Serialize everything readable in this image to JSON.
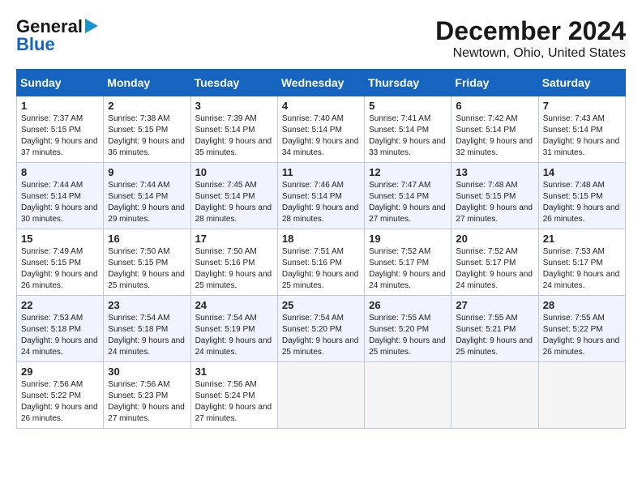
{
  "header": {
    "logo_line1": "General",
    "logo_line2": "Blue",
    "month": "December 2024",
    "location": "Newtown, Ohio, United States"
  },
  "days_of_week": [
    "Sunday",
    "Monday",
    "Tuesday",
    "Wednesday",
    "Thursday",
    "Friday",
    "Saturday"
  ],
  "weeks": [
    [
      {
        "day": "1",
        "sunrise": "7:37 AM",
        "sunset": "5:15 PM",
        "daylight": "9 hours and 37 minutes."
      },
      {
        "day": "2",
        "sunrise": "7:38 AM",
        "sunset": "5:15 PM",
        "daylight": "9 hours and 36 minutes."
      },
      {
        "day": "3",
        "sunrise": "7:39 AM",
        "sunset": "5:14 PM",
        "daylight": "9 hours and 35 minutes."
      },
      {
        "day": "4",
        "sunrise": "7:40 AM",
        "sunset": "5:14 PM",
        "daylight": "9 hours and 34 minutes."
      },
      {
        "day": "5",
        "sunrise": "7:41 AM",
        "sunset": "5:14 PM",
        "daylight": "9 hours and 33 minutes."
      },
      {
        "day": "6",
        "sunrise": "7:42 AM",
        "sunset": "5:14 PM",
        "daylight": "9 hours and 32 minutes."
      },
      {
        "day": "7",
        "sunrise": "7:43 AM",
        "sunset": "5:14 PM",
        "daylight": "9 hours and 31 minutes."
      }
    ],
    [
      {
        "day": "8",
        "sunrise": "7:44 AM",
        "sunset": "5:14 PM",
        "daylight": "9 hours and 30 minutes."
      },
      {
        "day": "9",
        "sunrise": "7:44 AM",
        "sunset": "5:14 PM",
        "daylight": "9 hours and 29 minutes."
      },
      {
        "day": "10",
        "sunrise": "7:45 AM",
        "sunset": "5:14 PM",
        "daylight": "9 hours and 28 minutes."
      },
      {
        "day": "11",
        "sunrise": "7:46 AM",
        "sunset": "5:14 PM",
        "daylight": "9 hours and 28 minutes."
      },
      {
        "day": "12",
        "sunrise": "7:47 AM",
        "sunset": "5:14 PM",
        "daylight": "9 hours and 27 minutes."
      },
      {
        "day": "13",
        "sunrise": "7:48 AM",
        "sunset": "5:15 PM",
        "daylight": "9 hours and 27 minutes."
      },
      {
        "day": "14",
        "sunrise": "7:48 AM",
        "sunset": "5:15 PM",
        "daylight": "9 hours and 26 minutes."
      }
    ],
    [
      {
        "day": "15",
        "sunrise": "7:49 AM",
        "sunset": "5:15 PM",
        "daylight": "9 hours and 26 minutes."
      },
      {
        "day": "16",
        "sunrise": "7:50 AM",
        "sunset": "5:15 PM",
        "daylight": "9 hours and 25 minutes."
      },
      {
        "day": "17",
        "sunrise": "7:50 AM",
        "sunset": "5:16 PM",
        "daylight": "9 hours and 25 minutes."
      },
      {
        "day": "18",
        "sunrise": "7:51 AM",
        "sunset": "5:16 PM",
        "daylight": "9 hours and 25 minutes."
      },
      {
        "day": "19",
        "sunrise": "7:52 AM",
        "sunset": "5:17 PM",
        "daylight": "9 hours and 24 minutes."
      },
      {
        "day": "20",
        "sunrise": "7:52 AM",
        "sunset": "5:17 PM",
        "daylight": "9 hours and 24 minutes."
      },
      {
        "day": "21",
        "sunrise": "7:53 AM",
        "sunset": "5:17 PM",
        "daylight": "9 hours and 24 minutes."
      }
    ],
    [
      {
        "day": "22",
        "sunrise": "7:53 AM",
        "sunset": "5:18 PM",
        "daylight": "9 hours and 24 minutes."
      },
      {
        "day": "23",
        "sunrise": "7:54 AM",
        "sunset": "5:18 PM",
        "daylight": "9 hours and 24 minutes."
      },
      {
        "day": "24",
        "sunrise": "7:54 AM",
        "sunset": "5:19 PM",
        "daylight": "9 hours and 24 minutes."
      },
      {
        "day": "25",
        "sunrise": "7:54 AM",
        "sunset": "5:20 PM",
        "daylight": "9 hours and 25 minutes."
      },
      {
        "day": "26",
        "sunrise": "7:55 AM",
        "sunset": "5:20 PM",
        "daylight": "9 hours and 25 minutes."
      },
      {
        "day": "27",
        "sunrise": "7:55 AM",
        "sunset": "5:21 PM",
        "daylight": "9 hours and 25 minutes."
      },
      {
        "day": "28",
        "sunrise": "7:55 AM",
        "sunset": "5:22 PM",
        "daylight": "9 hours and 26 minutes."
      }
    ],
    [
      {
        "day": "29",
        "sunrise": "7:56 AM",
        "sunset": "5:22 PM",
        "daylight": "9 hours and 26 minutes."
      },
      {
        "day": "30",
        "sunrise": "7:56 AM",
        "sunset": "5:23 PM",
        "daylight": "9 hours and 27 minutes."
      },
      {
        "day": "31",
        "sunrise": "7:56 AM",
        "sunset": "5:24 PM",
        "daylight": "9 hours and 27 minutes."
      },
      null,
      null,
      null,
      null
    ]
  ]
}
